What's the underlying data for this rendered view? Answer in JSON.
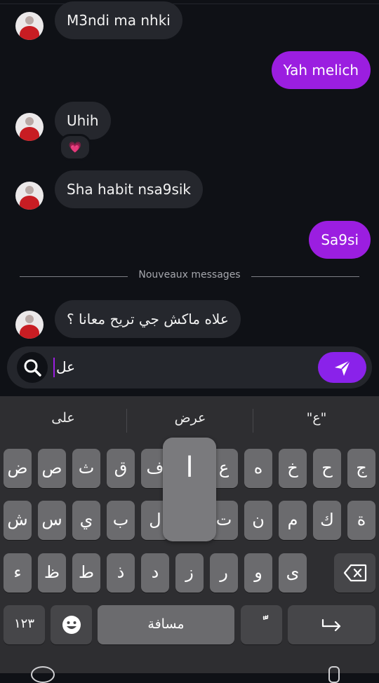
{
  "messages": [
    {
      "side": "in",
      "text": "M3ndi ma nhki"
    },
    {
      "side": "out",
      "text": "Yah melich"
    },
    {
      "side": "in",
      "text": "Uhih",
      "reaction": "💗"
    },
    {
      "side": "in",
      "text": "Sha habit nsa9sik"
    },
    {
      "side": "out",
      "text": "Sa9si"
    },
    {
      "side": "in",
      "text": "علاه ماكش جي تريح معانا ؟"
    }
  ],
  "divider": {
    "label": "Nouveaux messages"
  },
  "composer": {
    "typed_text": "عل"
  },
  "keyboard": {
    "suggestions": [
      "على",
      "عرض",
      "\"ع\""
    ],
    "row1": [
      "ض",
      "ص",
      "ث",
      "ق",
      "ف",
      "غ",
      "ع",
      "ه",
      "خ",
      "ح",
      "ج"
    ],
    "row2": [
      "ش",
      "س",
      "ي",
      "ب",
      "ل",
      "ا",
      "ت",
      "ن",
      "م",
      "ك",
      "ة"
    ],
    "row3": [
      "ء",
      "ظ",
      "ط",
      "ذ",
      "د",
      "ز",
      "ر",
      "و",
      "ى"
    ],
    "numbers_label": "١٢٣",
    "space_label": "مسافة",
    "diacritic_label": "ًّ",
    "popup_letter": "ا"
  },
  "colors": {
    "background": "#0f1116",
    "incoming": "#25272d",
    "outgoing": "#9b1ee0",
    "send": "#8a22ea"
  }
}
